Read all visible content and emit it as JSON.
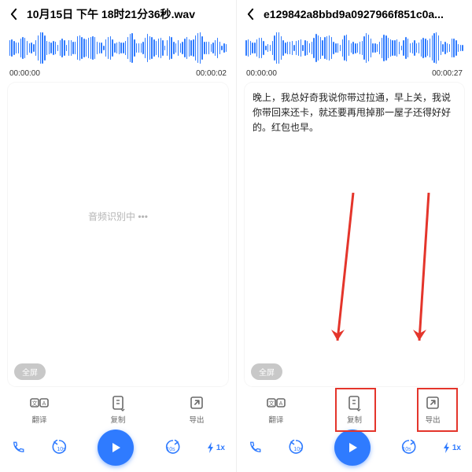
{
  "left": {
    "title": "10月15日 下午 18时21分36秒.wav",
    "time_start": "00:00:00",
    "time_end": "00:00:02",
    "placeholder": "音频识别中 •••",
    "fullscreen": "全屏"
  },
  "right": {
    "title": "e129842a8bbd9a0927966f851c0a...",
    "time_start": "00:00:00",
    "time_end": "00:00:27",
    "transcript": "晚上，我总好奇我说你带过拉通，早上关，我说你带回来还卡，就还要再甩掉那一屋子还得好好的。红包也早。",
    "fullscreen": "全屏"
  },
  "toolbar": {
    "translate": "翻译",
    "copy": "复制",
    "export": "导出"
  },
  "playbar": {
    "back10": "10s",
    "fwd10": "10s",
    "speed": "1x"
  },
  "icons": {
    "back": "chevron-left",
    "translate": "translate-icon",
    "copy": "copy-icon",
    "export": "export-icon",
    "call": "call-icon",
    "play": "play-icon",
    "bolt": "bolt-icon"
  }
}
